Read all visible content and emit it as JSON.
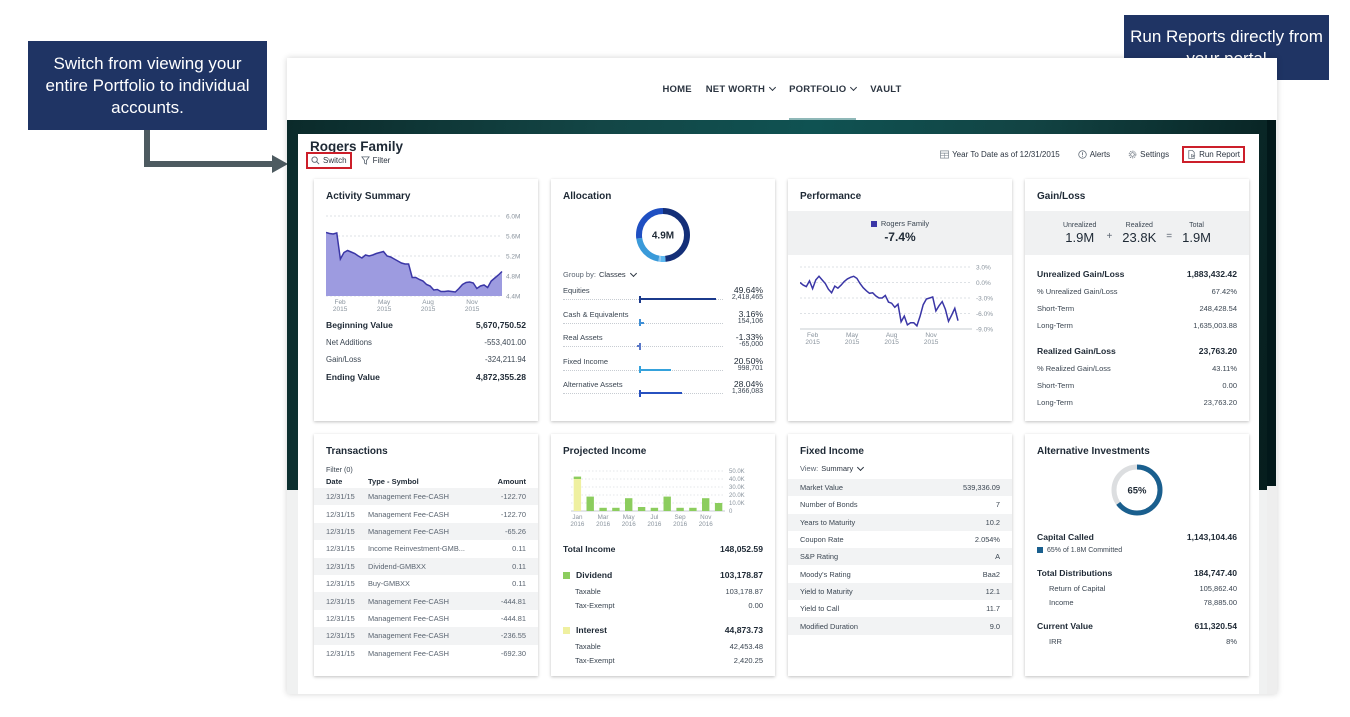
{
  "callouts": {
    "switch_note": "Switch from viewing your entire Portfolio to individual accounts.",
    "report_note": "Run Reports directly from your portal"
  },
  "nav": {
    "items": [
      {
        "label": "HOME",
        "dropdown": false,
        "active": false
      },
      {
        "label": "NET WORTH",
        "dropdown": true,
        "active": false
      },
      {
        "label": "PORTFOLIO",
        "dropdown": true,
        "active": true
      },
      {
        "label": "VAULT",
        "dropdown": false,
        "active": false
      }
    ]
  },
  "header": {
    "title": "Rogers Family",
    "switch_label": "Switch",
    "filter_label": "Filter",
    "date_range": "Year To Date as of 12/31/2015",
    "alerts_label": "Alerts",
    "settings_label": "Settings",
    "run_report_label": "Run Report",
    "highlight_color": "#cc1f2a"
  },
  "activity_summary": {
    "title": "Activity Summary",
    "rows": [
      {
        "label": "Beginning Value",
        "value": "5,670,750.52",
        "strong": true
      },
      {
        "label": "Net Additions",
        "value": "-553,401.00",
        "strong": false
      },
      {
        "label": "Gain/Loss",
        "value": "-324,211.94",
        "strong": false
      },
      {
        "label": "Ending Value",
        "value": "4,872,355.28",
        "strong": true
      }
    ]
  },
  "allocation": {
    "title": "Allocation",
    "total": "4.9M",
    "group_by_label": "Group by:",
    "group_by_value": "Classes",
    "items": [
      {
        "label": "Equities",
        "pct": "49.64%",
        "amount": "2,418,465",
        "pct_value": 49.64,
        "color": "#1b3a8c"
      },
      {
        "label": "Cash & Equivalents",
        "pct": "3.16%",
        "amount": "154,106",
        "pct_value": 3.16,
        "color": "#3f8fd6"
      },
      {
        "label": "Real Assets",
        "pct": "-1.33%",
        "amount": "-65,000",
        "pct_value": -1.33,
        "color": "#5a78c8"
      },
      {
        "label": "Fixed Income",
        "pct": "20.50%",
        "amount": "998,701",
        "pct_value": 20.5,
        "color": "#35a2dc"
      },
      {
        "label": "Alternative Assets",
        "pct": "28.04%",
        "amount": "1,366,083",
        "pct_value": 28.04,
        "color": "#2751c0"
      }
    ]
  },
  "performance": {
    "title": "Performance",
    "legend": "Rogers Family",
    "value": "-7.4%",
    "series_color": "#3a36a6"
  },
  "gain_loss": {
    "title": "Gain/Loss",
    "summary": {
      "unrealized_label": "Unrealized",
      "unrealized": "1.9M",
      "realized_label": "Realized",
      "realized": "23.8K",
      "total_label": "Total",
      "total": "1.9M",
      "plus": "+",
      "equals": "="
    },
    "rows": [
      {
        "label": "Unrealized Gain/Loss",
        "value": "1,883,432.42",
        "strong": true
      },
      {
        "label": "% Unrealized Gain/Loss",
        "value": "67.42%",
        "strong": false
      },
      {
        "label": "Short-Term",
        "value": "248,428.54",
        "strong": false
      },
      {
        "label": "Long-Term",
        "value": "1,635,003.88",
        "strong": false
      },
      {
        "label": "Realized Gain/Loss",
        "value": "23,763.20",
        "strong": true
      },
      {
        "label": "% Realized Gain/Loss",
        "value": "43.11%",
        "strong": false
      },
      {
        "label": "Short-Term",
        "value": "0.00",
        "strong": false
      },
      {
        "label": "Long-Term",
        "value": "23,763.20",
        "strong": false
      }
    ]
  },
  "transactions": {
    "title": "Transactions",
    "filter_label": "Filter (0)",
    "columns": [
      "Date",
      "Type - Symbol",
      "Amount"
    ],
    "rows": [
      [
        "12/31/15",
        "Management Fee-CASH",
        "-122.70"
      ],
      [
        "12/31/15",
        "Management Fee-CASH",
        "-122.70"
      ],
      [
        "12/31/15",
        "Management Fee-CASH",
        "-65.26"
      ],
      [
        "12/31/15",
        "Income Reinvestment-GMB...",
        "0.11"
      ],
      [
        "12/31/15",
        "Dividend-GMBXX",
        "0.11"
      ],
      [
        "12/31/15",
        "Buy-GMBXX",
        "0.11"
      ],
      [
        "12/31/15",
        "Management Fee-CASH",
        "-444.81"
      ],
      [
        "12/31/15",
        "Management Fee-CASH",
        "-444.81"
      ],
      [
        "12/31/15",
        "Management Fee-CASH",
        "-236.55"
      ],
      [
        "12/31/15",
        "Management Fee-CASH",
        "-692.30"
      ]
    ]
  },
  "projected_income": {
    "title": "Projected Income",
    "total_label": "Total Income",
    "total": "148,052.59",
    "dividend": {
      "label": "Dividend",
      "value": "103,178.87",
      "color": "#8ccd5e",
      "taxable_label": "Taxable",
      "taxable": "103,178.87",
      "exempt_label": "Tax-Exempt",
      "exempt": "0.00"
    },
    "interest": {
      "label": "Interest",
      "value": "44,873.73",
      "color": "#eff0a0",
      "taxable_label": "Taxable",
      "taxable": "42,453.48",
      "exempt_label": "Tax-Exempt",
      "exempt": "2,420.25"
    }
  },
  "fixed_income": {
    "title": "Fixed Income",
    "view_label": "View:",
    "view_value": "Summary",
    "rows": [
      {
        "label": "Market Value",
        "value": "539,336.09"
      },
      {
        "label": "Number of Bonds",
        "value": "7"
      },
      {
        "label": "Years to Maturity",
        "value": "10.2"
      },
      {
        "label": "Coupon Rate",
        "value": "2.054%"
      },
      {
        "label": "S&P Rating",
        "value": "A"
      },
      {
        "label": "Moody's Rating",
        "value": "Baa2"
      },
      {
        "label": "Yield to Maturity",
        "value": "12.1"
      },
      {
        "label": "Yield to Call",
        "value": "11.7"
      },
      {
        "label": "Modified Duration",
        "value": "9.0"
      }
    ]
  },
  "alternative_investments": {
    "title": "Alternative Investments",
    "called_pct": 65,
    "called_pct_label": "65%",
    "ring_color": "#1a5f8e",
    "capital_called_label": "Capital Called",
    "capital_called": "1,143,104.46",
    "committed_note": "65% of 1.8M Committed",
    "total_distributions_label": "Total Distributions",
    "total_distributions": "184,747.40",
    "return_of_capital_label": "Return of Capital",
    "return_of_capital": "105,862.40",
    "income_label": "Income",
    "income": "78,885.00",
    "current_value_label": "Current Value",
    "current_value": "611,320.54",
    "irr_label": "IRR",
    "irr": "8%"
  },
  "chart_data": [
    {
      "id": "activity",
      "type": "area",
      "title": "Activity Summary",
      "ylim": [
        4.4,
        6.0
      ],
      "yticks": [
        "6.0M",
        "5.6M",
        "5.2M",
        "4.8M",
        "4.4M"
      ],
      "ytick_values": [
        6.0,
        5.6,
        5.2,
        4.8,
        4.4
      ],
      "xticks": [
        {
          "label": "Feb",
          "sub": "2015",
          "pos": 0.08
        },
        {
          "label": "May",
          "sub": "2015",
          "pos": 0.33
        },
        {
          "label": "Aug",
          "sub": "2015",
          "pos": 0.58
        },
        {
          "label": "Nov",
          "sub": "2015",
          "pos": 0.83
        }
      ],
      "color": "#3a36a6",
      "fill": "#9d9be0",
      "values": [
        5.67,
        5.65,
        5.64,
        5.66,
        5.14,
        5.27,
        5.31,
        5.28,
        5.25,
        5.2,
        5.16,
        5.22,
        5.2,
        5.22,
        5.25,
        5.27,
        5.29,
        5.2,
        5.18,
        5.14,
        5.1,
        5.06,
        5.04,
        5.04,
        4.77,
        4.77,
        4.73,
        4.7,
        4.63,
        4.6,
        4.52,
        4.53,
        4.49,
        4.49,
        4.5,
        4.49,
        4.48,
        4.55,
        4.63,
        4.67,
        4.68,
        4.66,
        4.55,
        4.6,
        4.62,
        4.57,
        4.7,
        4.76,
        4.82,
        4.89
      ]
    },
    {
      "id": "performance",
      "type": "line",
      "title": "Performance",
      "ylim": [
        -9.0,
        3.0
      ],
      "yticks": [
        "3.0%",
        "0.0%",
        "-3.0%",
        "-6.0%",
        "-9.0%"
      ],
      "ytick_values": [
        3,
        0,
        -3,
        -6,
        -9
      ],
      "xticks": [
        {
          "label": "Feb",
          "sub": "2015",
          "pos": 0.08
        },
        {
          "label": "May",
          "sub": "2015",
          "pos": 0.33
        },
        {
          "label": "Aug",
          "sub": "2015",
          "pos": 0.58
        },
        {
          "label": "Nov",
          "sub": "2015",
          "pos": 0.83
        }
      ],
      "series": [
        {
          "name": "Rogers Family",
          "values": [
            0.0,
            -0.5,
            -0.8,
            0.3,
            -1.2,
            0.5,
            1.2,
            0.5,
            -0.2,
            -1.3,
            -2.0,
            -0.7,
            -1.1,
            -0.5,
            0.2,
            0.7,
            1.0,
            1.2,
            0.8,
            -0.2,
            -1.0,
            -1.6,
            -2.1,
            -2.0,
            -2.6,
            -3.0,
            -3.0,
            -2.5,
            -3.8,
            -4.0,
            -4.8,
            -4.2,
            -7.6,
            -6.5,
            -8.2,
            -7.8,
            -7.8,
            -8.4,
            -6.5,
            -4.3,
            -3.2,
            -3.0,
            -2.8,
            -5.5,
            -4.5,
            -3.7,
            -5.2,
            -7.5,
            -6.3,
            -5.0,
            -7.4
          ]
        }
      ]
    },
    {
      "id": "projected_income",
      "type": "bar",
      "title": "Projected Income",
      "ylim": [
        0,
        50
      ],
      "yticks": [
        "50.0K",
        "40.0K",
        "30.0K",
        "20.0K",
        "10.0K",
        "0"
      ],
      "ytick_values": [
        50,
        40,
        30,
        20,
        10,
        0
      ],
      "categories": [
        "Jan 2016",
        "Feb 2016",
        "Mar 2016",
        "Apr 2016",
        "May 2016",
        "Jun 2016",
        "Jul 2016",
        "Aug 2016",
        "Sep 2016",
        "Oct 2016",
        "Nov 2016",
        "Dec 2016"
      ],
      "xtick_labels": [
        {
          "label": "Jan",
          "sub": "2016",
          "index": 0
        },
        {
          "label": "Mar",
          "sub": "2016",
          "index": 2
        },
        {
          "label": "May",
          "sub": "2016",
          "index": 4
        },
        {
          "label": "Jul",
          "sub": "2016",
          "index": 6
        },
        {
          "label": "Sep",
          "sub": "2016",
          "index": 8
        },
        {
          "label": "Nov",
          "sub": "2016",
          "index": 10
        }
      ],
      "series": [
        {
          "name": "Interest",
          "color": "#eff0a0",
          "values": [
            40,
            0,
            0,
            0,
            0,
            0,
            0,
            0,
            0,
            0,
            0,
            0
          ]
        },
        {
          "name": "Dividend",
          "color": "#8ccd5e",
          "values": [
            3,
            18,
            4,
            4,
            16,
            5,
            4,
            18,
            4,
            4,
            16,
            10
          ]
        }
      ]
    },
    {
      "id": "allocation",
      "type": "pie",
      "title": "Allocation",
      "labels": [
        "Equities",
        "Cash & Equivalents",
        "Real Assets",
        "Fixed Income",
        "Alternative Assets"
      ],
      "values": [
        49.64,
        3.16,
        1.33,
        20.5,
        28.04
      ],
      "colors": [
        "#142f78",
        "#5cb8f0",
        "#8ac6f2",
        "#3a9ad9",
        "#1f4fc2"
      ]
    }
  ]
}
